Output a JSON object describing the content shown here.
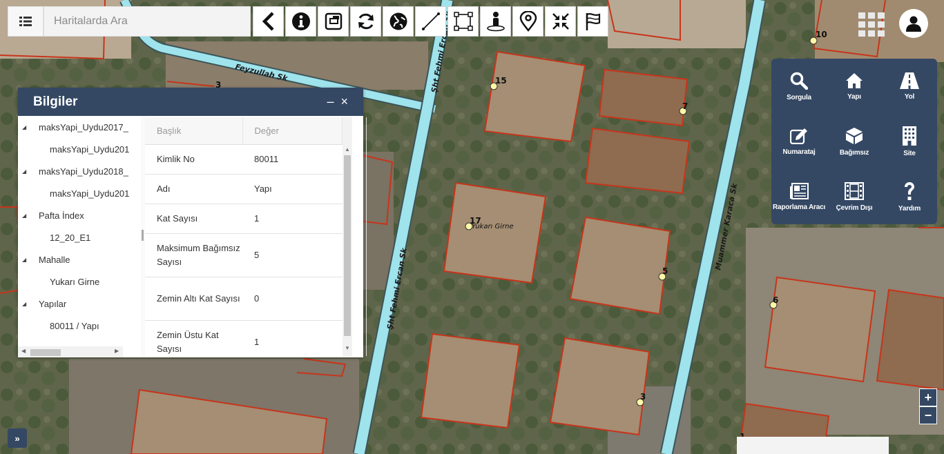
{
  "search": {
    "placeholder": "Haritalarda Ara"
  },
  "toolbar": {
    "menu_icon": "list-icon",
    "tools": [
      "back-icon",
      "info-icon",
      "window-icon",
      "refresh-icon",
      "globe-icon",
      "line-measure-icon",
      "area-select-icon",
      "person-pin-icon",
      "location-pin-icon",
      "collapse-icon",
      "flag-icon"
    ],
    "apps_icon": "grid-icon",
    "user_icon": "user-icon"
  },
  "map": {
    "streets": [
      "Feyzullah Sk",
      "Şht Fehmi Ercan Sk",
      "Şht Fehmi Ercan Sk",
      "Muammer Karaca Sk"
    ],
    "place_label": "Yukarı Girne",
    "parcel_numbers": [
      "3",
      "10",
      "15",
      "7",
      "17",
      "5",
      "6",
      "3",
      "1"
    ],
    "colors": {
      "parcel_border": "#c7341a",
      "road": "#9fe3ec",
      "road_edge": "#4a6e74"
    }
  },
  "panel": {
    "title": "Bilgiler",
    "minimize": "–",
    "close": "×",
    "tree": [
      {
        "label": "maksYapi_Uydu2017_",
        "level": 0
      },
      {
        "label": "maksYapi_Uydu201",
        "level": 1
      },
      {
        "label": "maksYapi_Uydu2018_",
        "level": 0
      },
      {
        "label": "maksYapi_Uydu201",
        "level": 1
      },
      {
        "label": "Pafta İndex",
        "level": 0
      },
      {
        "label": "12_20_E1",
        "level": 1
      },
      {
        "label": "Mahalle",
        "level": 0
      },
      {
        "label": "Yukarı Girne",
        "level": 1
      },
      {
        "label": "Yapılar",
        "level": 0
      },
      {
        "label": "80011 / Yapı",
        "level": 1
      }
    ],
    "columns": {
      "key": "Başlık",
      "value": "Değer"
    },
    "rows": [
      {
        "key": "Kimlik No",
        "value": "80011"
      },
      {
        "key": "Adı",
        "value": "Yapı"
      },
      {
        "key": "Kat Sayısı",
        "value": "1"
      },
      {
        "key": "Maksimum Bağımsız Sayısı",
        "value": "5"
      },
      {
        "key": "Zemin Altı Kat Sayısı",
        "value": "0"
      },
      {
        "key": "Zemin Üstu Kat Sayısı",
        "value": "1"
      }
    ]
  },
  "right_menu": {
    "items": [
      {
        "label": "Sorgula",
        "icon": "search-icon"
      },
      {
        "label": "Yapı",
        "icon": "home-icon"
      },
      {
        "label": "Yol",
        "icon": "road-icon"
      },
      {
        "label": "Numarataj",
        "icon": "edit-icon"
      },
      {
        "label": "Bağımsız",
        "icon": "cube-icon"
      },
      {
        "label": "Site",
        "icon": "building-icon"
      },
      {
        "label": "Raporlama Aracı",
        "icon": "newspaper-icon"
      },
      {
        "label": "Çevrim Dışı",
        "icon": "film-icon"
      },
      {
        "label": "Yardım",
        "icon": "question-icon"
      }
    ]
  },
  "zoom": {
    "in": "+",
    "out": "−"
  },
  "expand": "»"
}
